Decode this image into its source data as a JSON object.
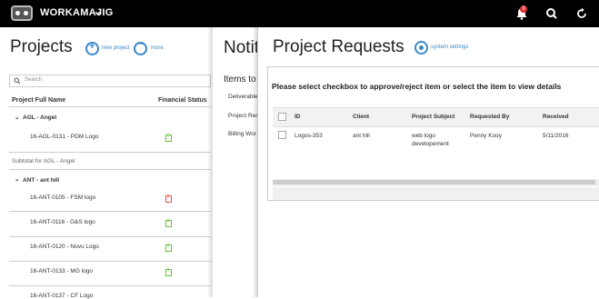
{
  "app": {
    "brand": "WORKAMAJIG",
    "notification_count": "9"
  },
  "projects": {
    "title": "Projects",
    "new_project_label": "new project",
    "more_label": "more",
    "search_placeholder": "Search",
    "columns": [
      "Project Full Name",
      "Financial Status"
    ],
    "groups": [
      {
        "header": "AGL - Angel",
        "rows": [
          {
            "name": "16-AGL-0131 - PDM Logo",
            "status": "ok"
          }
        ],
        "subtotal": "Subtotal for AGL - Angel"
      },
      {
        "header": "ANT - ant hill",
        "rows": [
          {
            "name": "16-ANT-0105 - FSM logo",
            "status": "alert"
          },
          {
            "name": "16-ANT-0116 - G&S logo",
            "status": "ok"
          },
          {
            "name": "16-ANT-0120 - Novu Logo",
            "status": "ok"
          },
          {
            "name": "16-ANT-0133 - MG logo",
            "status": "ok"
          },
          {
            "name": "16-ANT-0137 - CF Logo",
            "status": "ok"
          }
        ]
      }
    ]
  },
  "notifications": {
    "title": "Notit",
    "subtitle": "Items to",
    "items": [
      "Deliverable",
      "Project Rec",
      "Billing Wor"
    ]
  },
  "requests": {
    "title": "Project Requests",
    "system_settings_label": "system settings",
    "message": "Please select checkbox to approve/reject item or select the item to view details",
    "columns": [
      "ID",
      "Client",
      "Project Subject",
      "Requested By",
      "Received"
    ],
    "rows": [
      {
        "id": "Logos-353",
        "client": "ant hill",
        "subject_line1": "web logo",
        "subject_line2": "developement",
        "requested_by": "Penny Kooy",
        "received": "5/11/2016"
      }
    ]
  },
  "colors": {
    "topbar": "#000000",
    "accent": "#3b87c8",
    "status_ok": "#6bbd3b",
    "status_alert": "#d9534f",
    "badge": "#e02a2a"
  }
}
